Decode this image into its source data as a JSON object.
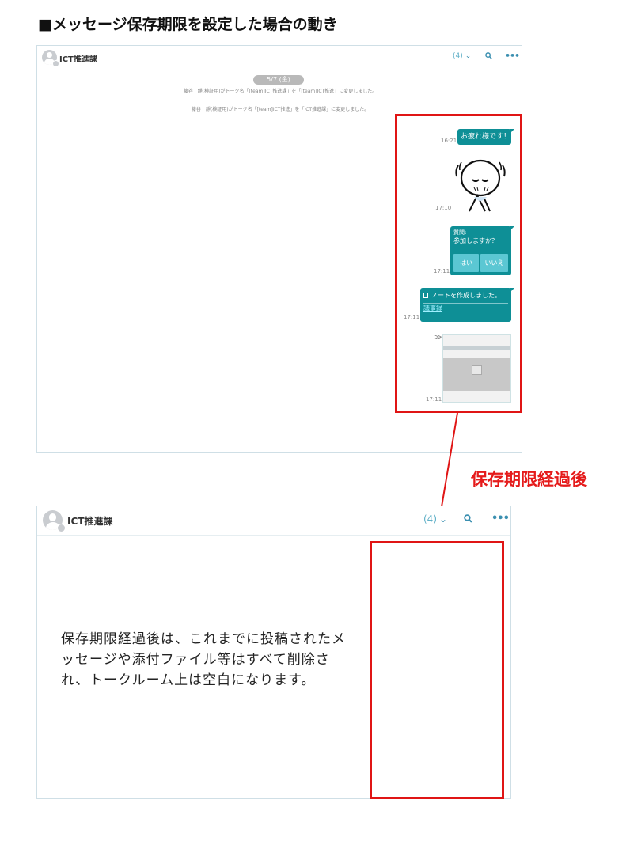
{
  "heading": "■メッセージ保存期限を設定した場合の動き",
  "before": {
    "room_title": "ICT推進課",
    "member_count": "(4)",
    "date_label": "5/7 (金)",
    "system_messages": [
      "藤谷　靜(検証用)がトーク名「[team]ICT推進課」を「[team]ICT推進」に変更しました。",
      "藤谷　靜(検証用)がトーク名「[team]ICT推進」を「ICT推進課」に変更しました。"
    ],
    "messages": {
      "greeting": {
        "text": "お疲れ様です！",
        "time": "16:21"
      },
      "sticker": {
        "time": "17:10"
      },
      "question": {
        "title": "質問:",
        "text": "参加しますか？",
        "yes": "はい",
        "no": "いいえ",
        "time": "17:11"
      },
      "note": {
        "text": "ノートを作成しました。",
        "link": "議事録",
        "time": "17:11"
      },
      "image": {
        "time": "17:11"
      }
    }
  },
  "after_label": "保存期限経過後",
  "after": {
    "room_title": "ICT推進課",
    "member_count": "(4)",
    "explanation": "保存期限経過後は、これまでに投稿されたメッセージや添付ファイル等はすべて削除され、トークルーム上は空白になります。"
  },
  "colors": {
    "accent": "#0e8f96",
    "highlight_red": "#e01515",
    "header_blue": "#3a8fb0"
  },
  "icons": [
    "avatar-icon",
    "chevron-down-icon",
    "search-icon",
    "more-icon",
    "document-icon",
    "double-chevron-icon",
    "image-icon"
  ]
}
